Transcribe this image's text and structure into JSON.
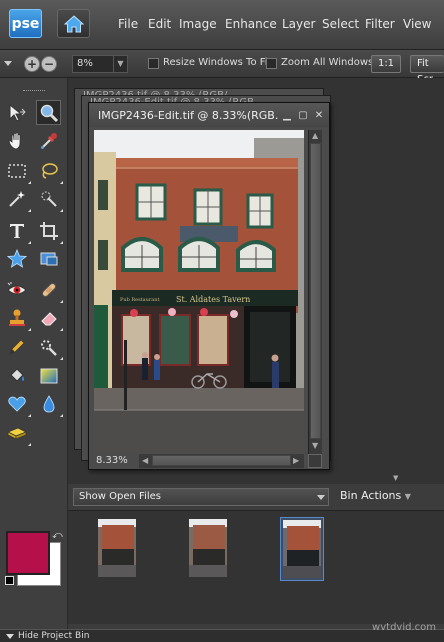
{
  "app": {
    "logo_text": "pse"
  },
  "menu": [
    "File",
    "Edit",
    "Image",
    "Enhance",
    "Layer",
    "Select",
    "Filter",
    "View"
  ],
  "options_bar": {
    "zoom_value": "8%",
    "resize_windows_label": "Resize Windows To Fit",
    "zoom_all_windows_label": "Zoom All Windows",
    "one_to_one_label": "1:1",
    "fit_screen_label": "Fit Scr"
  },
  "stacked_windows": [
    {
      "title": "IMGP2436-Edit.tif @ 8.33% (RGB..."
    },
    {
      "title": "IMGP2436.tif @ 8.33% (RGB/..."
    }
  ],
  "document": {
    "title": "IMGP2436-Edit.tif @ 8.33%(RGB...",
    "zoom_status": "8.33%",
    "sign_text": "St. Aldates Tavern",
    "left_sign_text": "Pub Restaurant",
    "right_sign_text": "St. Aldates"
  },
  "project_bin": {
    "show_label": "Show Open Files",
    "actions_label": "Bin Actions",
    "thumbnails": [
      {
        "name": "thumb-1",
        "selected": false
      },
      {
        "name": "thumb-2",
        "selected": false
      },
      {
        "name": "thumb-3",
        "selected": true
      }
    ]
  },
  "colors": {
    "foreground": "#b5104a",
    "background": "#ffffff",
    "accent": "#1f6fbf"
  },
  "bottom_bar": {
    "hide_bin_label": "Hide Project Bin"
  },
  "watermark": "wvtdvid.com"
}
